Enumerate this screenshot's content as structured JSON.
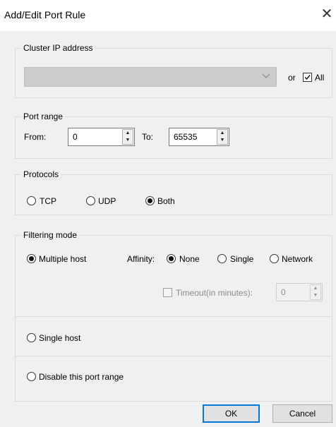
{
  "window": {
    "title": "Add/Edit Port Rule",
    "close_glyph": "✕"
  },
  "cluster_ip": {
    "legend": "Cluster IP address",
    "combo_value": "",
    "or_label": "or",
    "all_label": "All",
    "all_checked": true
  },
  "port_range": {
    "legend": "Port range",
    "from_label": "From:",
    "from_value": "0",
    "to_label": "To:",
    "to_value": "65535"
  },
  "protocols": {
    "legend": "Protocols",
    "options": [
      "TCP",
      "UDP",
      "Both"
    ],
    "selected": "Both"
  },
  "filtering": {
    "legend": "Filtering mode",
    "multiple_host_label": "Multiple host",
    "affinity_label": "Affinity:",
    "affinity_options": [
      "None",
      "Single",
      "Network"
    ],
    "affinity_selected": "None",
    "timeout_label": "Timeout(in minutes):",
    "timeout_value": "0",
    "single_host_label": "Single host",
    "disable_label": "Disable this port range",
    "mode_selected": "Multiple host"
  },
  "buttons": {
    "ok": "OK",
    "cancel": "Cancel"
  }
}
